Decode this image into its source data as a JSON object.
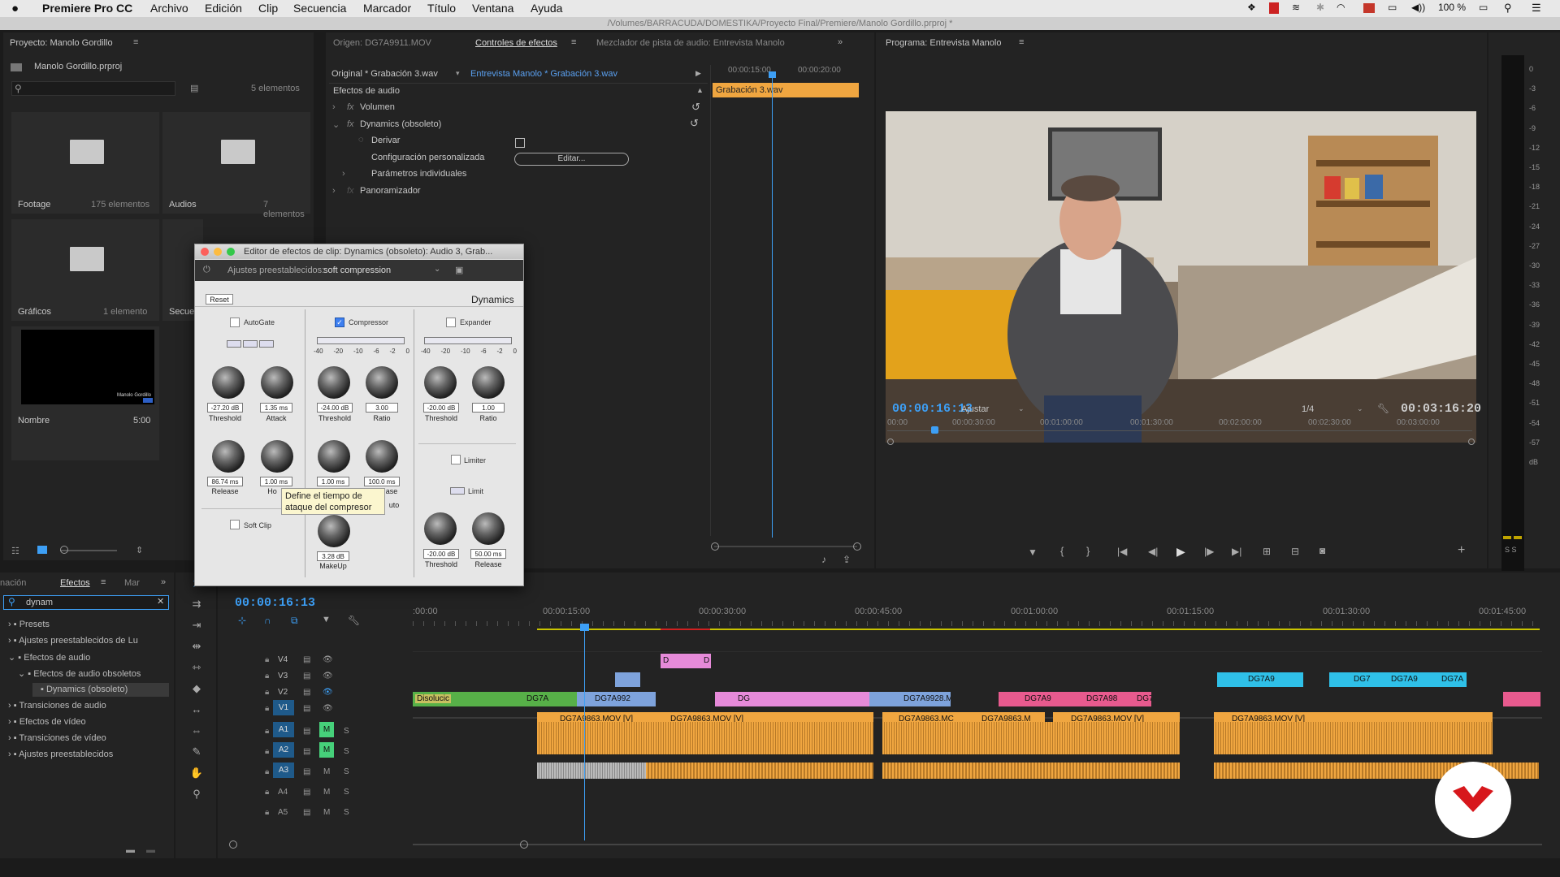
{
  "menubar": {
    "app": "Premiere Pro CC",
    "items": [
      "Archivo",
      "Edición",
      "Clip",
      "Secuencia",
      "Marcador",
      "Título",
      "Ventana",
      "Ayuda"
    ],
    "battery": "100 %"
  },
  "window_title": "/Volumes/BARRACUDA/DOMESTIKA/Proyecto Final/Premiere/Manolo Gordillo.prproj *",
  "project": {
    "title": "Proyecto: Manolo Gordillo",
    "file": "Manolo Gordillo.prproj",
    "count": "5 elementos",
    "bins": [
      {
        "name": "Footage",
        "count": "175 elementos"
      },
      {
        "name": "Audios",
        "count": "7 elementos"
      },
      {
        "name": "Gráficos",
        "count": "1 elemento"
      },
      {
        "name": "Secuen",
        "count": ""
      },
      {
        "name": "Nombre",
        "count": "5:00"
      }
    ],
    "thumb_text": "Manolo Gordillo"
  },
  "source_tabs": {
    "source": "Origen: DG7A9911.MOV",
    "effect_controls": "Controles de efectos",
    "mixer": "Mezclador de pista de audio: Entrevista Manolo"
  },
  "effect_controls": {
    "original": "Original * Grabación 3.wav",
    "sequence": "Entrevista Manolo * Grabación 3.wav",
    "tc1": "00:00:15:00",
    "tc2": "00:00:20:00",
    "clip": "Grabación 3.wav",
    "section": "Efectos de audio",
    "volumen": "Volumen",
    "dynamics": "Dynamics (obsoleto)",
    "derivar": "Derivar",
    "config": "Configuración personalizada",
    "editar": "Editar...",
    "params": "Parámetros individuales",
    "panner": "Panoramizador"
  },
  "program": {
    "title": "Programa: Entrevista Manolo",
    "timecode": "00:00:16:13",
    "fit": "Ajustar",
    "quality": "1/4",
    "duration": "00:03:16:20",
    "ruler": [
      "00:00",
      "00:00:30:00",
      "00:01:00:00",
      "00:01:30:00",
      "00:02:00:00",
      "00:02:30:00",
      "00:03:00:00"
    ],
    "meter": [
      "0",
      "-3",
      "-6",
      "-9",
      "-12",
      "-15",
      "-18",
      "-21",
      "-24",
      "-27",
      "-30",
      "-33",
      "-36",
      "-39",
      "-42",
      "-45",
      "-48",
      "-51",
      "-54",
      "-57",
      "dB"
    ],
    "meter_ss": "S S"
  },
  "dialog": {
    "title": "Editor de efectos de clip: Dynamics (obsoleto): Audio 3, Grab...",
    "presets_label": "Ajustes preestablecidos:",
    "preset": "soft compression",
    "reset": "Reset",
    "plugin": "Dynamics",
    "autogate": "AutoGate",
    "compressor": "Compressor",
    "expander": "Expander",
    "limiter": "Limiter",
    "limit": "Limit",
    "softclip": "Soft Clip",
    "scale": [
      "-40",
      "-20",
      "-10",
      "-6",
      "-2",
      "0"
    ],
    "gate_knobs": [
      {
        "value": "-27.20 dB",
        "label": "Threshold"
      },
      {
        "value": "1.35 ms",
        "label": "Attack"
      },
      {
        "value": "86.74 ms",
        "label": "Release"
      },
      {
        "value": "1.00 ms",
        "label": "Ho"
      }
    ],
    "comp_knobs": [
      {
        "value": "-24.00 dB",
        "label": "Threshold"
      },
      {
        "value": "3.00",
        "label": "Ratio"
      },
      {
        "value": "1.00 ms",
        "label": ""
      },
      {
        "value": "100.0 ms",
        "label": "ase"
      },
      {
        "value": "3.28 dB",
        "label": "MakeUp"
      }
    ],
    "comp_auto": "uto",
    "exp_knobs": [
      {
        "value": "-20.00 dB",
        "label": "Threshold"
      },
      {
        "value": "1.00",
        "label": "Ratio"
      }
    ],
    "lim_knobs": [
      {
        "value": "-20.00 dB",
        "label": "Threshold"
      },
      {
        "value": "50.00 ms",
        "label": "Release"
      }
    ],
    "tooltip": "Define el tiempo de ataque del compresor"
  },
  "effects_panel": {
    "tabs": [
      "nación",
      "Efectos",
      "Mar"
    ],
    "search": "dynam",
    "items": [
      "Presets",
      "Ajustes preestablecidos de Lu",
      "Efectos de audio",
      "Efectos de audio obsoletos",
      "Dynamics (obsoleto)",
      "Transiciones de audio",
      "Efectos de vídeo",
      "Transiciones de vídeo",
      "Ajustes preestablecidos"
    ]
  },
  "timeline": {
    "timecode": "00:00:16:13",
    "ruler": [
      ":00:00",
      "00:00:15:00",
      "00:00:30:00",
      "00:00:45:00",
      "00:01:00:00",
      "00:01:15:00",
      "00:01:30:00",
      "00:01:45:00"
    ],
    "tracks": [
      "V4",
      "V3",
      "V2",
      "V1",
      "A1",
      "A2",
      "A3",
      "A4",
      "A5"
    ],
    "clips": {
      "disolucion": "Disolucic",
      "v2a": "DG7A",
      "v2b": "DG7A992",
      "v2c": "DG",
      "v2d": "DG7A9928.M",
      "v2e": "DG7A9",
      "v2f": "DG7A98",
      "v2g": "DG7",
      "v3a": "DG7A9",
      "v3b": "DG7",
      "v3c": "DG7A9",
      "v3d": "DG7A",
      "v1a": "DG7A9863.MOV [V]",
      "v1b": "DG7A9863.MOV [V]",
      "v1c": "DG7A9863.MC",
      "v1d": "DG7A9863.M",
      "v1e": "DG7A9863.MOV [V]",
      "v1f": "DG7A9863.MOV [V]",
      "v4a": "D",
      "v4b": "D"
    }
  },
  "colors": {
    "accent": "#3d9ff5",
    "orange": "#f0a640",
    "pink": "#e68ad9",
    "green": "#57b048",
    "cyan": "#2fc0e8",
    "logo": "#d7171c"
  }
}
